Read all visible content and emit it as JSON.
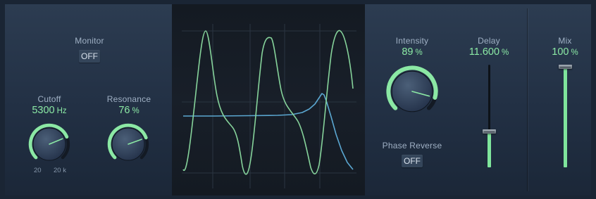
{
  "monitor": {
    "label": "Monitor",
    "button": "OFF"
  },
  "cutoff": {
    "label": "Cutoff",
    "value": "5300",
    "unit": "Hz",
    "range_min": "20",
    "range_max": "20 k",
    "knob_fraction": 0.75
  },
  "resonance": {
    "label": "Resonance",
    "value": "76",
    "unit": "%",
    "knob_fraction": 0.76
  },
  "intensity": {
    "label": "Intensity",
    "value": "89",
    "unit": "%",
    "knob_fraction": 0.89
  },
  "phase_reverse": {
    "label": "Phase Reverse",
    "button": "OFF"
  },
  "delay": {
    "label": "Delay",
    "value": "11.600",
    "unit": "%",
    "slider_fraction": 0.34
  },
  "mix": {
    "label": "Mix",
    "value": "100",
    "unit": "%",
    "slider_fraction": 1.0
  },
  "colors": {
    "accent_green": "#8be8a4",
    "curve_green": "#86d39b",
    "curve_blue": "#5ba7d1",
    "panel_bg": "#263649",
    "display_bg": "#161c25"
  }
}
